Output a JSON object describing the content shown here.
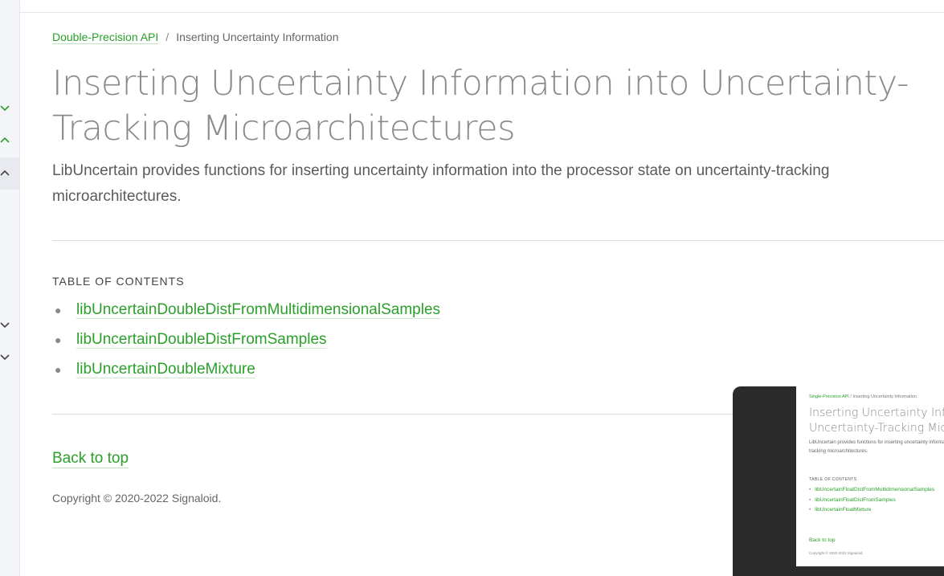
{
  "breadcrumb": {
    "parent": "Double-Precision API",
    "separator": "/",
    "current": "Inserting Uncertainty Information"
  },
  "page": {
    "title": "Inserting Uncertainty Information into Uncertainty-Tracking Microarchitectures",
    "lead": "LibUncertain provides functions for inserting uncertainty information into the processor state on uncertainty-tracking microarchitectures."
  },
  "toc": {
    "heading": "TABLE OF CONTENTS",
    "items": [
      "libUncertainDoubleDistFromMultidimensionalSamples",
      "libUncertainDoubleDistFromSamples",
      "libUncertainDoubleMixture"
    ]
  },
  "footer": {
    "back_to_top": "Back to top",
    "copyright": "Copyright © 2020-2022 Signaloid."
  },
  "preview": {
    "breadcrumb_parent": "Single-Precision API",
    "breadcrumb_current": "Inserting Uncertainty Information",
    "title": "Inserting Uncertainty Information into Uncertainty-Tracking Microarchitectures",
    "lead": "LibUncertain provides functions for inserting uncertainty information into the processor state on uncertainty-tracking microarchitectures.",
    "toc_heading": "TABLE OF CONTENTS",
    "toc_items": [
      "libUncertainFloatDistFromMultidimensionalSamples",
      "libUncertainFloatDistFromSamples",
      "libUncertainFloatMixture"
    ],
    "back_to_top": "Back to top",
    "copyright": "Copyright © 2020-2022 Signaloid."
  },
  "sidebar": {
    "icons": [
      "chevron-down-icon",
      "chevron-up-icon",
      "chevron-up-icon",
      "chevron-down-icon",
      "chevron-down-icon"
    ]
  },
  "colors": {
    "accent": "#2aa02a",
    "title": "#8a8a8a",
    "body": "#5a5a5a",
    "divider": "#dddddd",
    "sidebar_bg": "#f4f5f9"
  }
}
